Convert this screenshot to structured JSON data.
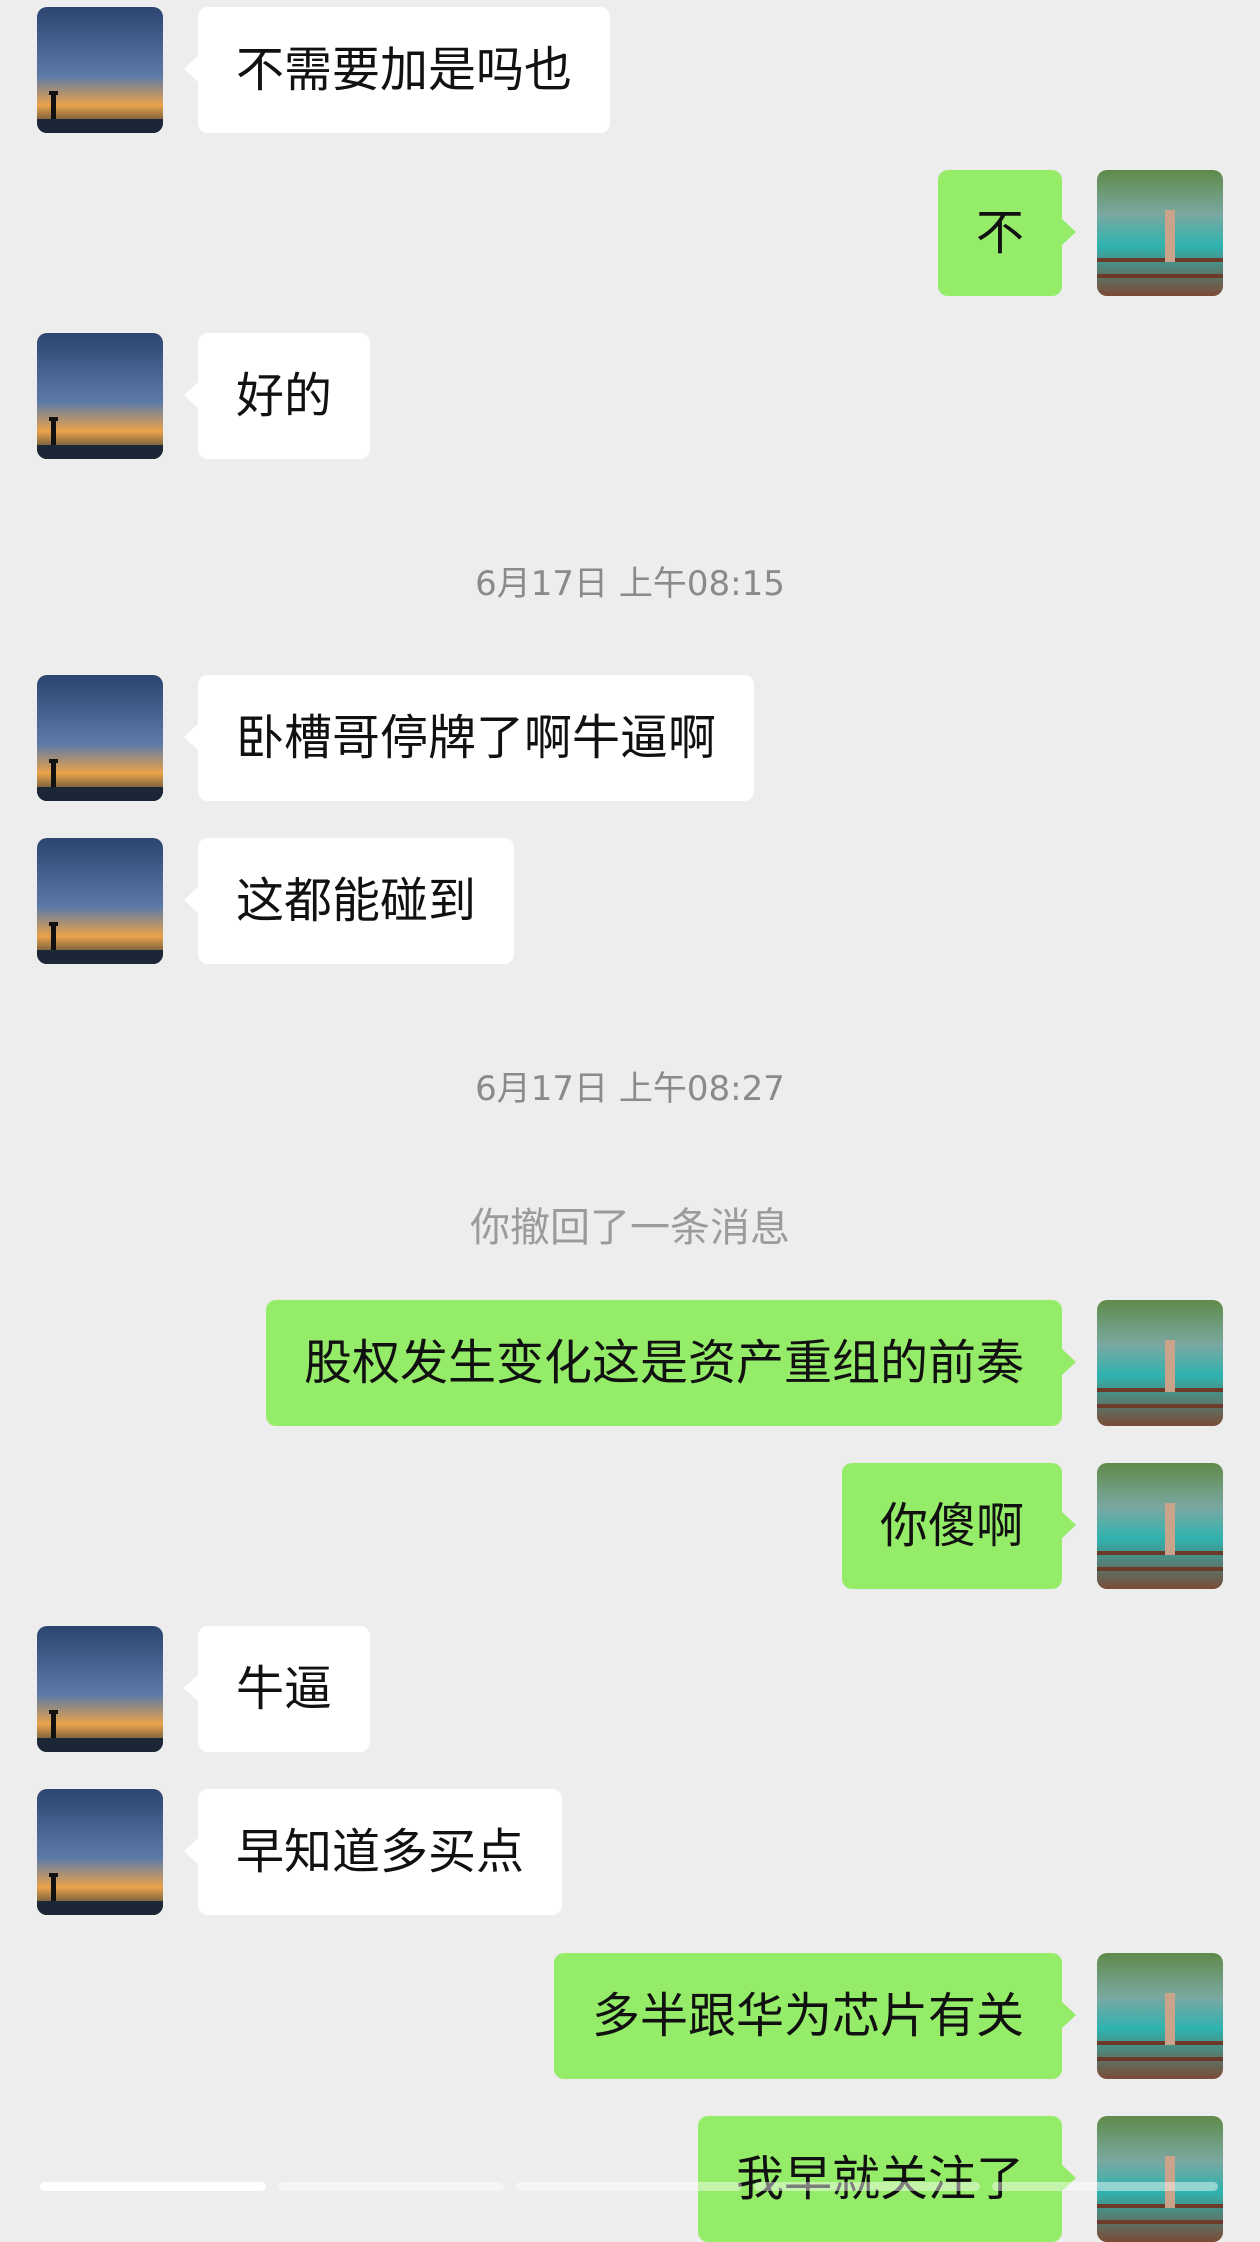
{
  "chat": {
    "messages": [
      {
        "id": "m1",
        "side": "in",
        "text": "不需要加是吗也"
      },
      {
        "id": "m2",
        "side": "out",
        "text": "不"
      },
      {
        "id": "m3",
        "side": "in",
        "text": "好的"
      },
      {
        "id": "t1",
        "type": "timestamp",
        "text": "6月17日 上午08:15"
      },
      {
        "id": "m4",
        "side": "in",
        "text": "卧槽哥停牌了啊牛逼啊"
      },
      {
        "id": "m5",
        "side": "in",
        "text": "这都能碰到"
      },
      {
        "id": "t2",
        "type": "timestamp",
        "text": "6月17日 上午08:27"
      },
      {
        "id": "s1",
        "type": "system",
        "text": "你撤回了一条消息"
      },
      {
        "id": "m6",
        "side": "out",
        "text": "股权发生变化这是资产重组的前奏"
      },
      {
        "id": "m7",
        "side": "out",
        "text": "你傻啊"
      },
      {
        "id": "m8",
        "side": "in",
        "text": "牛逼"
      },
      {
        "id": "m9",
        "side": "in",
        "text": "早知道多买点"
      },
      {
        "id": "m10",
        "side": "out",
        "text": "多半跟华为芯片有关"
      },
      {
        "id": "m11",
        "side": "out",
        "text": "我早就关注了"
      }
    ]
  },
  "avatars": {
    "contact": "sunset-lighthouse-avatar",
    "self": "lake-railing-avatar"
  },
  "colors": {
    "background": "#ededed",
    "incoming_bubble": "#ffffff",
    "outgoing_bubble": "#95ec69",
    "timestamp_text": "#8a8a8a"
  }
}
